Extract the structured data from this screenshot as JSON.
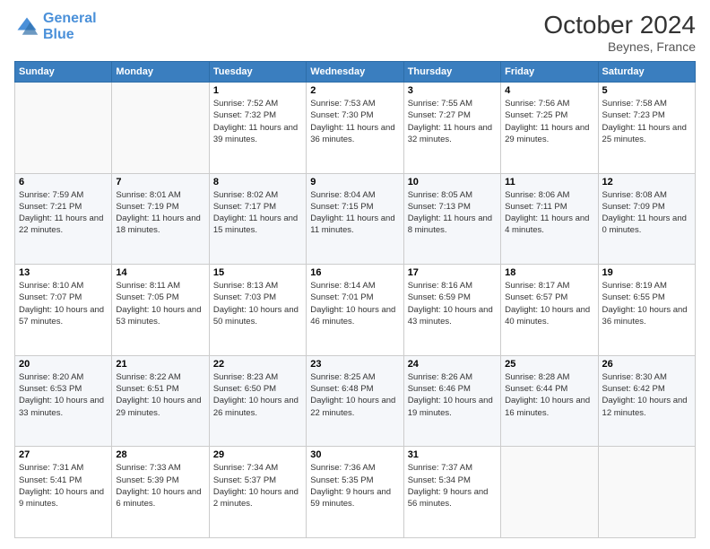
{
  "header": {
    "logo_line1": "General",
    "logo_line2": "Blue",
    "title": "October 2024",
    "subtitle": "Beynes, France"
  },
  "columns": [
    "Sunday",
    "Monday",
    "Tuesday",
    "Wednesday",
    "Thursday",
    "Friday",
    "Saturday"
  ],
  "weeks": [
    [
      {
        "day": "",
        "info": ""
      },
      {
        "day": "",
        "info": ""
      },
      {
        "day": "1",
        "info": "Sunrise: 7:52 AM\nSunset: 7:32 PM\nDaylight: 11 hours and 39 minutes."
      },
      {
        "day": "2",
        "info": "Sunrise: 7:53 AM\nSunset: 7:30 PM\nDaylight: 11 hours and 36 minutes."
      },
      {
        "day": "3",
        "info": "Sunrise: 7:55 AM\nSunset: 7:27 PM\nDaylight: 11 hours and 32 minutes."
      },
      {
        "day": "4",
        "info": "Sunrise: 7:56 AM\nSunset: 7:25 PM\nDaylight: 11 hours and 29 minutes."
      },
      {
        "day": "5",
        "info": "Sunrise: 7:58 AM\nSunset: 7:23 PM\nDaylight: 11 hours and 25 minutes."
      }
    ],
    [
      {
        "day": "6",
        "info": "Sunrise: 7:59 AM\nSunset: 7:21 PM\nDaylight: 11 hours and 22 minutes."
      },
      {
        "day": "7",
        "info": "Sunrise: 8:01 AM\nSunset: 7:19 PM\nDaylight: 11 hours and 18 minutes."
      },
      {
        "day": "8",
        "info": "Sunrise: 8:02 AM\nSunset: 7:17 PM\nDaylight: 11 hours and 15 minutes."
      },
      {
        "day": "9",
        "info": "Sunrise: 8:04 AM\nSunset: 7:15 PM\nDaylight: 11 hours and 11 minutes."
      },
      {
        "day": "10",
        "info": "Sunrise: 8:05 AM\nSunset: 7:13 PM\nDaylight: 11 hours and 8 minutes."
      },
      {
        "day": "11",
        "info": "Sunrise: 8:06 AM\nSunset: 7:11 PM\nDaylight: 11 hours and 4 minutes."
      },
      {
        "day": "12",
        "info": "Sunrise: 8:08 AM\nSunset: 7:09 PM\nDaylight: 11 hours and 0 minutes."
      }
    ],
    [
      {
        "day": "13",
        "info": "Sunrise: 8:10 AM\nSunset: 7:07 PM\nDaylight: 10 hours and 57 minutes."
      },
      {
        "day": "14",
        "info": "Sunrise: 8:11 AM\nSunset: 7:05 PM\nDaylight: 10 hours and 53 minutes."
      },
      {
        "day": "15",
        "info": "Sunrise: 8:13 AM\nSunset: 7:03 PM\nDaylight: 10 hours and 50 minutes."
      },
      {
        "day": "16",
        "info": "Sunrise: 8:14 AM\nSunset: 7:01 PM\nDaylight: 10 hours and 46 minutes."
      },
      {
        "day": "17",
        "info": "Sunrise: 8:16 AM\nSunset: 6:59 PM\nDaylight: 10 hours and 43 minutes."
      },
      {
        "day": "18",
        "info": "Sunrise: 8:17 AM\nSunset: 6:57 PM\nDaylight: 10 hours and 40 minutes."
      },
      {
        "day": "19",
        "info": "Sunrise: 8:19 AM\nSunset: 6:55 PM\nDaylight: 10 hours and 36 minutes."
      }
    ],
    [
      {
        "day": "20",
        "info": "Sunrise: 8:20 AM\nSunset: 6:53 PM\nDaylight: 10 hours and 33 minutes."
      },
      {
        "day": "21",
        "info": "Sunrise: 8:22 AM\nSunset: 6:51 PM\nDaylight: 10 hours and 29 minutes."
      },
      {
        "day": "22",
        "info": "Sunrise: 8:23 AM\nSunset: 6:50 PM\nDaylight: 10 hours and 26 minutes."
      },
      {
        "day": "23",
        "info": "Sunrise: 8:25 AM\nSunset: 6:48 PM\nDaylight: 10 hours and 22 minutes."
      },
      {
        "day": "24",
        "info": "Sunrise: 8:26 AM\nSunset: 6:46 PM\nDaylight: 10 hours and 19 minutes."
      },
      {
        "day": "25",
        "info": "Sunrise: 8:28 AM\nSunset: 6:44 PM\nDaylight: 10 hours and 16 minutes."
      },
      {
        "day": "26",
        "info": "Sunrise: 8:30 AM\nSunset: 6:42 PM\nDaylight: 10 hours and 12 minutes."
      }
    ],
    [
      {
        "day": "27",
        "info": "Sunrise: 7:31 AM\nSunset: 5:41 PM\nDaylight: 10 hours and 9 minutes."
      },
      {
        "day": "28",
        "info": "Sunrise: 7:33 AM\nSunset: 5:39 PM\nDaylight: 10 hours and 6 minutes."
      },
      {
        "day": "29",
        "info": "Sunrise: 7:34 AM\nSunset: 5:37 PM\nDaylight: 10 hours and 2 minutes."
      },
      {
        "day": "30",
        "info": "Sunrise: 7:36 AM\nSunset: 5:35 PM\nDaylight: 9 hours and 59 minutes."
      },
      {
        "day": "31",
        "info": "Sunrise: 7:37 AM\nSunset: 5:34 PM\nDaylight: 9 hours and 56 minutes."
      },
      {
        "day": "",
        "info": ""
      },
      {
        "day": "",
        "info": ""
      }
    ]
  ]
}
